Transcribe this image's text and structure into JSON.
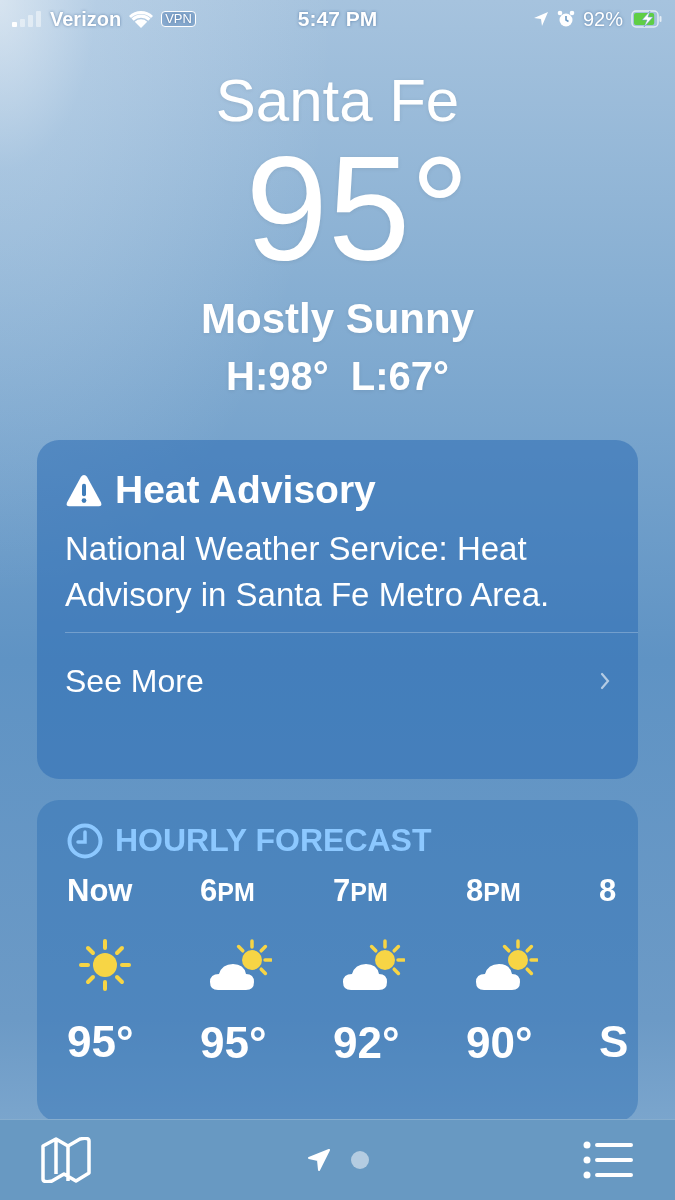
{
  "status_bar": {
    "carrier": "Verizon",
    "vpn": "VPN",
    "time": "5:47 PM",
    "battery": "92%",
    "charging": true
  },
  "location": {
    "city": "Santa Fe",
    "temperature": "95°",
    "condition": "Mostly Sunny",
    "high": "H:98°",
    "low": "L:67°"
  },
  "alert": {
    "title": "Heat Advisory",
    "body": "National Weather Service: Heat Advisory in Santa Fe Metro Area.",
    "link": "See More"
  },
  "hourly": {
    "title": "HOURLY FORECAST",
    "items": [
      {
        "hour": "Now",
        "kind": "sunny",
        "temp": "95°"
      },
      {
        "hour": "6",
        "suffix": "PM",
        "kind": "partly-cloudy",
        "temp": "95°"
      },
      {
        "hour": "7",
        "suffix": "PM",
        "kind": "partly-cloudy",
        "temp": "92°"
      },
      {
        "hour": "8",
        "suffix": "PM",
        "kind": "partly-cloudy",
        "temp": "90°"
      },
      {
        "hour": "8",
        "kind": "none",
        "temp": "S"
      }
    ]
  },
  "pages": [
    {
      "kind": "location",
      "selected": true
    },
    {
      "kind": "dot",
      "selected": false
    }
  ]
}
